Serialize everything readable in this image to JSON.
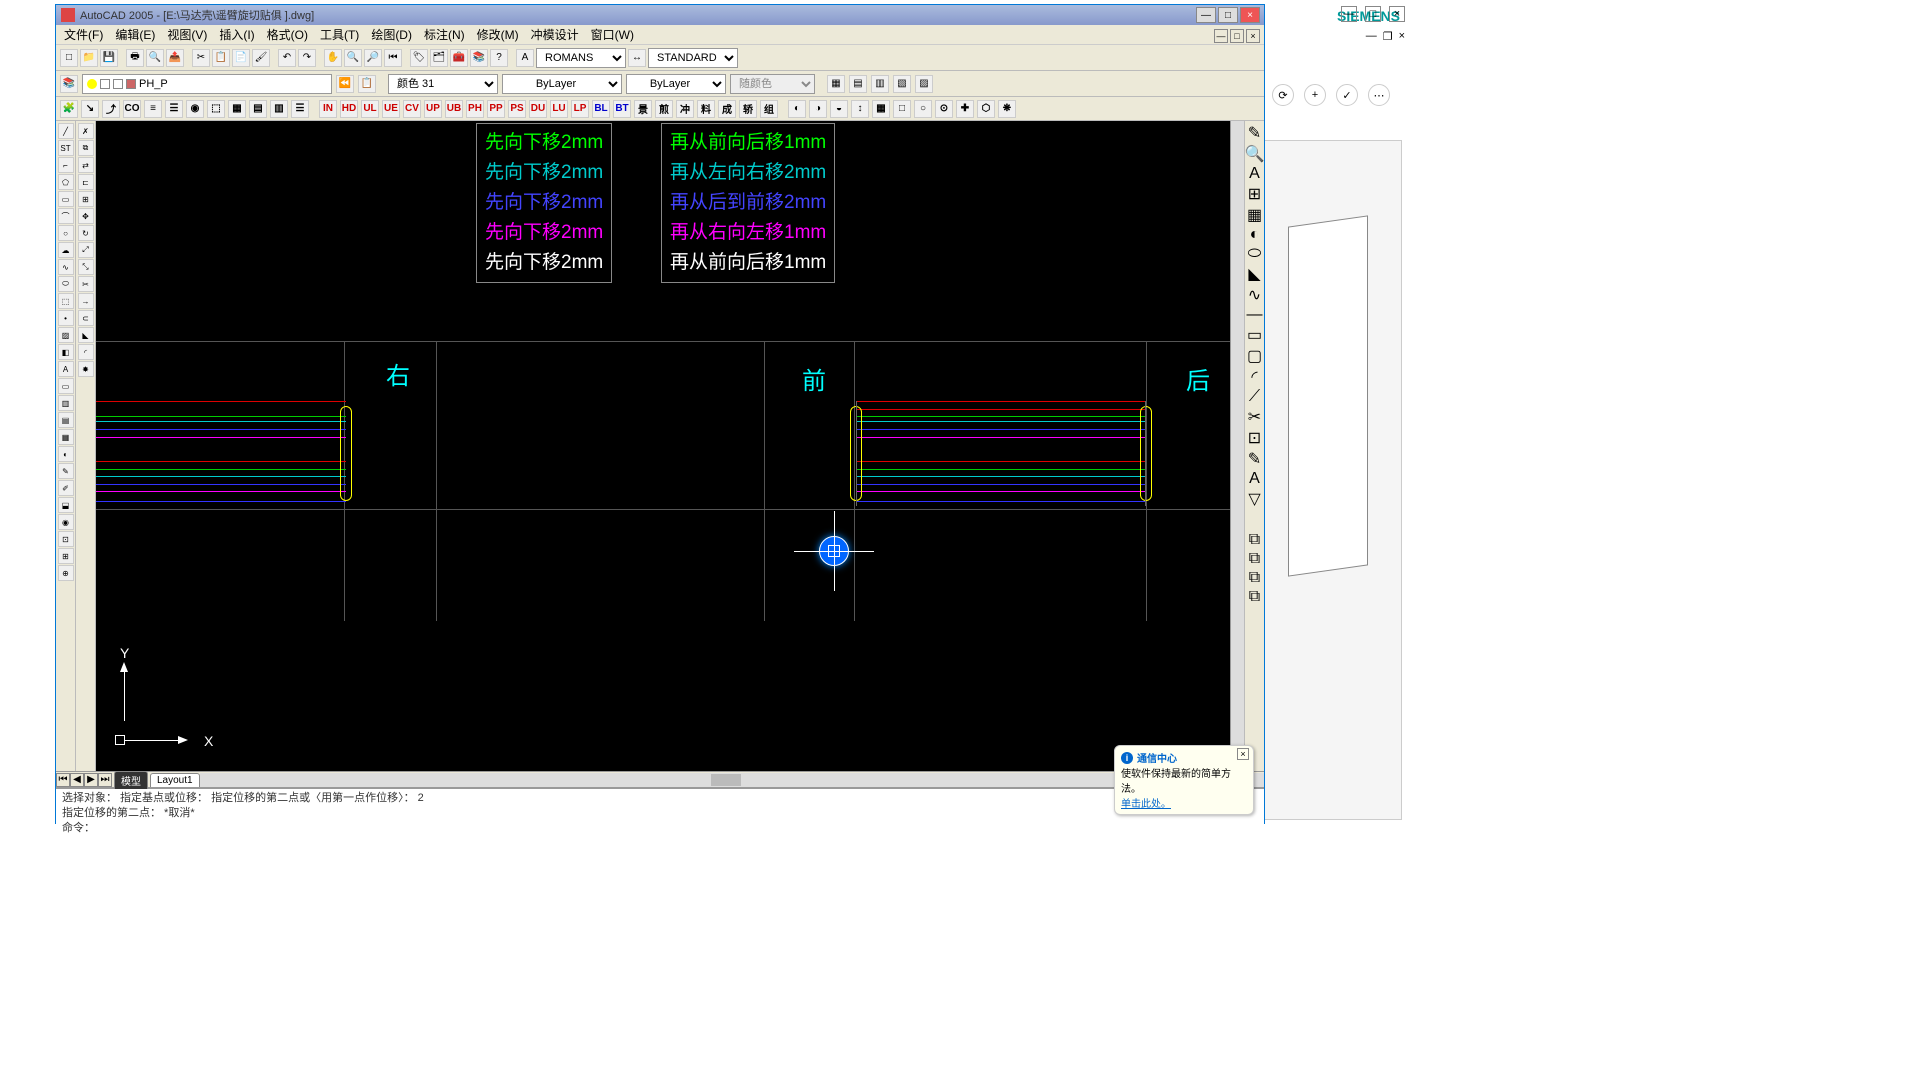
{
  "siemens": {
    "brand": "SIEMENS"
  },
  "acad": {
    "title": "AutoCAD 2005 - [E:\\马达壳\\遥臂旋切贴俱 ].dwg]",
    "menus": [
      "文件(F)",
      "编辑(E)",
      "视图(V)",
      "插入(I)",
      "格式(O)",
      "工具(T)",
      "绘图(D)",
      "标注(N)",
      "修改(M)",
      "冲模设计",
      "窗口(W)"
    ]
  },
  "layer": {
    "name": "PH_P"
  },
  "props": {
    "color_label": "颜色 31",
    "ltype": "ByLayer",
    "lweight": "ByLayer",
    "color_sel": "随颜色"
  },
  "style": {
    "font": "ROMANS",
    "dim": "STANDARD"
  },
  "htool": [
    "IN",
    "HD",
    "UL",
    "UE",
    "CV",
    "UP",
    "UB",
    "PH",
    "PP",
    "PS",
    "DU",
    "LU",
    "LP",
    "BL",
    "BT",
    "景",
    "煎",
    "冲",
    "料",
    "成",
    "轿",
    "组"
  ],
  "legend_left": [
    {
      "text": "先向下移2mm",
      "color": "#00ff00"
    },
    {
      "text": "先向下移2mm",
      "color": "#00cccc"
    },
    {
      "text": "先向下移2mm",
      "color": "#3333ff"
    },
    {
      "text": "先向下移2mm",
      "color": "#ff00ff"
    },
    {
      "text": "先向下移2mm",
      "color": "#ffffff"
    }
  ],
  "legend_right": [
    {
      "text": "再从前向后移1mm",
      "color": "#00ff00"
    },
    {
      "text": "再从左向右移2mm",
      "color": "#00cccc"
    },
    {
      "text": "再从后到前移2mm",
      "color": "#3333ff"
    },
    {
      "text": "再从右向左移1mm",
      "color": "#ff00ff"
    },
    {
      "text": "再从前向后移1mm",
      "color": "#ffffff"
    }
  ],
  "views": {
    "right": "右",
    "front": "前",
    "back": "后"
  },
  "ucs": {
    "x": "X",
    "y": "Y"
  },
  "tabs": {
    "model": "模型",
    "layout1": "Layout1"
  },
  "cmd": {
    "line1": "选择对象：  指定基点或位移：  指定位移的第二点或〈用第一点作位移〉：  2",
    "line2": "指定位移的第二点：  *取消*",
    "prompt": "命令："
  },
  "balloon": {
    "title": "通信中心",
    "body": "使软件保持最新的简单方法。",
    "link": "单击此处。"
  }
}
